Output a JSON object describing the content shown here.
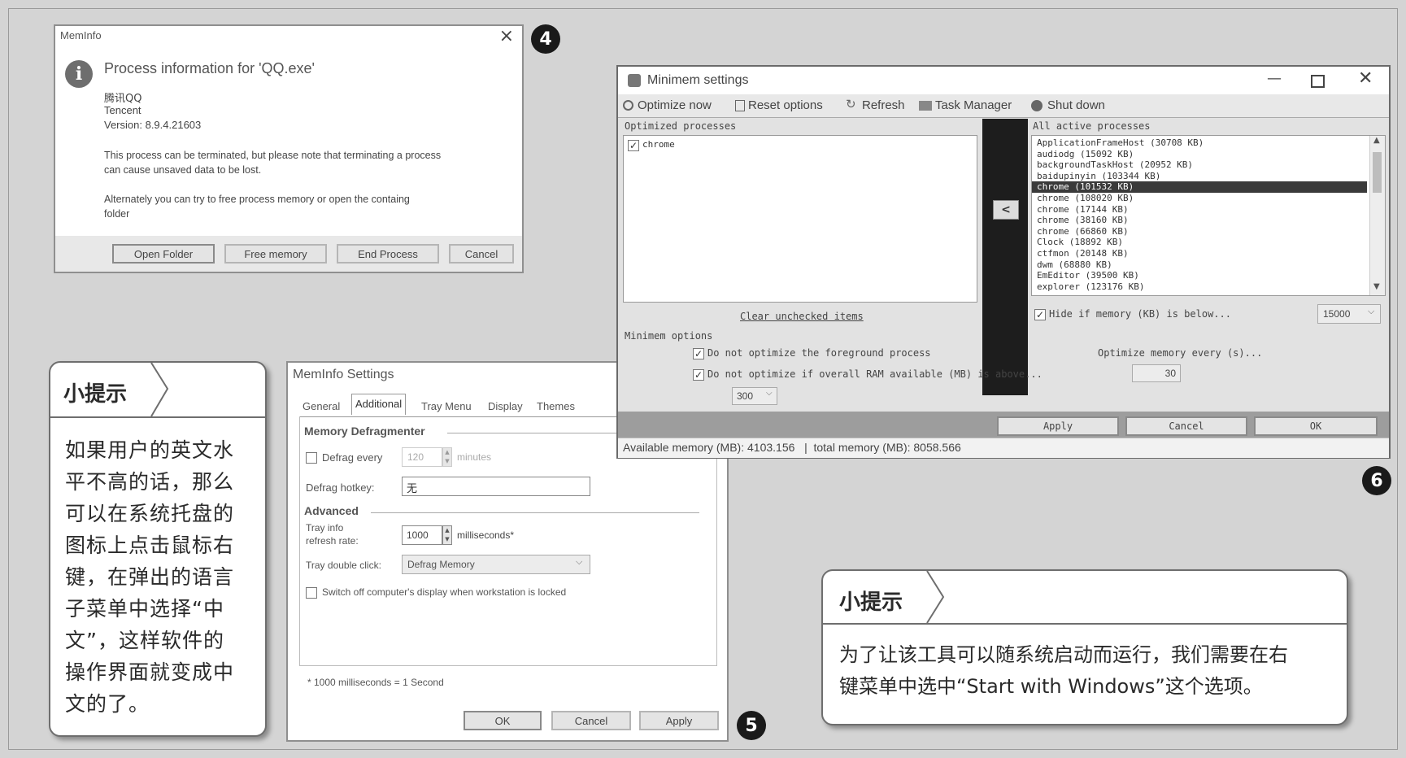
{
  "badges": {
    "b4": "4",
    "b5": "5",
    "b6": "6"
  },
  "meminfo_dialog": {
    "title": "MemInfo",
    "heading": "Process information for  'QQ.exe'",
    "process_name": "腾讯QQ",
    "company": "Tencent",
    "version": "Version: 8.9.4.21603",
    "message1_line1": "This process can be terminated, but please note that terminating a process",
    "message1_line2": "can cause unsaved data to be lost.",
    "message2_line1": "Alternately you can try to free process memory or open the containg",
    "message2_line2": "folder",
    "buttons": {
      "open_folder": "Open Folder",
      "free_memory": "Free memory",
      "end_process": "End Process",
      "cancel": "Cancel"
    },
    "close_glyph": "×"
  },
  "meminfo_settings": {
    "title": "MemInfo Settings",
    "tabs": [
      "General",
      "Additional",
      "Tray Menu",
      "Display",
      "Themes"
    ],
    "memory_defragmenter": "Memory Defragmenter",
    "defrag_every": "Defrag every",
    "defrag_every_value": "120",
    "minutes": "minutes",
    "defrag_hotkey": "Defrag hotkey:",
    "defrag_hotkey_value": "无",
    "advanced": "Advanced",
    "tray_info_line1": "Tray info",
    "tray_info_line2": "refresh rate:",
    "refresh_value": "1000",
    "milliseconds": "milliseconds*",
    "tray_double_click": "Tray double click:",
    "tray_double_click_value": "Defrag Memory",
    "switch_off": "Switch off computer's display when workstation is locked",
    "footnote": "* 1000 milliseconds = 1 Second",
    "buttons": {
      "ok": "OK",
      "cancel": "Cancel",
      "apply": "Apply"
    }
  },
  "minimem": {
    "title": "Minimem settings",
    "toolbar": {
      "optimize_now": "Optimize now",
      "reset_options": "Reset options",
      "refresh": "Refresh",
      "task_manager": "Task Manager",
      "shut_down": "Shut down"
    },
    "optimized_processes_label": "Optimized processes",
    "optimized_items": [
      "chrome"
    ],
    "all_active_label": "All active processes",
    "active_processes": [
      "ApplicationFrameHost (30708 KB)",
      "audiodg (15092 KB)",
      "backgroundTaskHost (20952 KB)",
      "baidupinyin (103344 KB)",
      "chrome (101532 KB)",
      "chrome (108020 KB)",
      "chrome (17144 KB)",
      "chrome (38160 KB)",
      "chrome (66860 KB)",
      "Clock (18892 KB)",
      "ctfmon (20148 KB)",
      "dwm (68880 KB)",
      "EmEditor (39500 KB)",
      "explorer (123176 KB)"
    ],
    "selected_index": 4,
    "move_button": "<",
    "clear_unchecked": "Clear unchecked items",
    "hide_if_memory": "Hide if memory (KB) is below...",
    "hide_value": "15000",
    "minimem_options": "Minimem options",
    "opt_foreground": "Do not optimize the foreground process",
    "opt_ram": "Do not optimize if overall RAM available (MB) is above...",
    "ram_value": "300",
    "optimize_every": "Optimize memory every (s)...",
    "optimize_every_value": "30",
    "buttons": {
      "apply": "Apply",
      "cancel": "Cancel",
      "ok": "OK"
    },
    "status": "Available memory (MB): 4103.156   |  total memory (MB): 8058.566"
  },
  "tip_left": {
    "title": "小提示",
    "lines": [
      "如果用户的英文水",
      "平不高的话，那么",
      "可以在系统托盘的",
      "图标上点击鼠标右",
      "键，在弹出的语言",
      "子菜单中选择“中",
      "文”，这样软件的",
      "操作界面就变成中",
      "文的了。"
    ]
  },
  "tip_right": {
    "title": "小提示",
    "lines": [
      "为了让该工具可以随系统启动而运行，我们需要在右",
      "键菜单中选中“Start with Windows”这个选项。"
    ]
  }
}
